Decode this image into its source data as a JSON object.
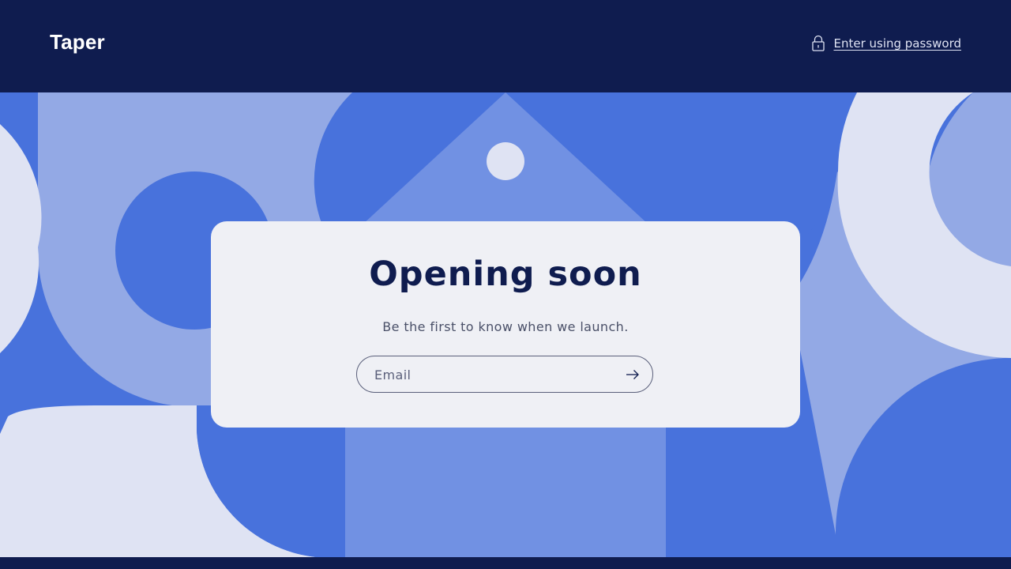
{
  "header": {
    "logo_text": "Taper",
    "password_link_label": "Enter using password",
    "password_icon": "lock-icon"
  },
  "card": {
    "title": "Opening soon",
    "subtitle": "Be the first to know when we launch.",
    "email_placeholder": "Email",
    "email_value": "",
    "submit_icon": "arrow-right-icon"
  },
  "colors": {
    "navy": "#0f1c4f",
    "royal_blue": "#4872dc",
    "periwinkle": "#93a9e5",
    "mid_blue": "#7191e3",
    "pale": "#dfe3f3",
    "card_bg": "#eff0f5"
  }
}
